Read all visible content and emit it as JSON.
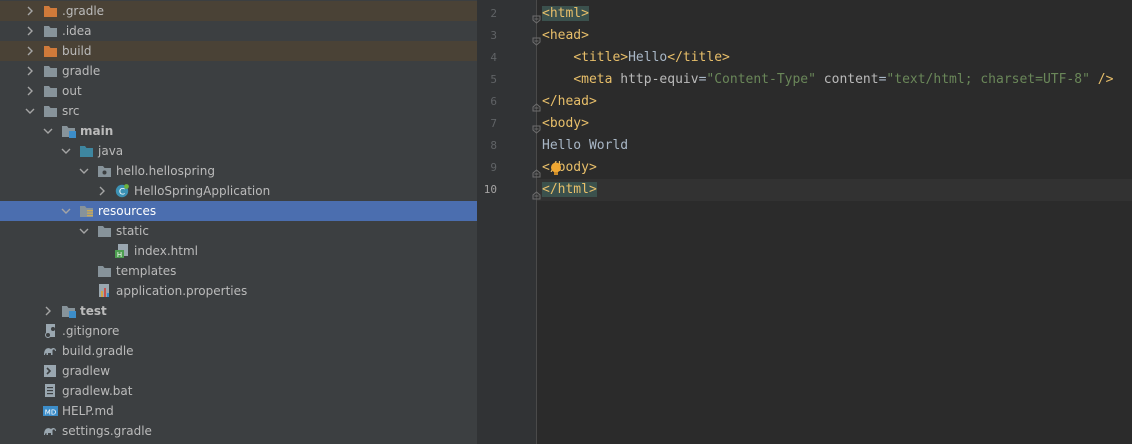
{
  "project_tree": {
    "items": [
      {
        "label": ".gradle",
        "icon": "folder-excluded-icon",
        "expand": "collapsed",
        "state": "excluded",
        "bold": false
      },
      {
        "label": ".idea",
        "icon": "folder-icon",
        "expand": "collapsed",
        "state": "normal",
        "bold": false
      },
      {
        "label": "build",
        "icon": "folder-excluded-icon",
        "expand": "collapsed",
        "state": "excluded",
        "bold": false
      },
      {
        "label": "gradle",
        "icon": "folder-icon",
        "expand": "collapsed",
        "state": "normal",
        "bold": false
      },
      {
        "label": "out",
        "icon": "folder-icon",
        "expand": "collapsed",
        "state": "normal",
        "bold": false
      },
      {
        "label": "src",
        "icon": "folder-icon",
        "expand": "expanded",
        "state": "normal",
        "bold": false
      },
      {
        "label": "main",
        "icon": "module-folder-icon",
        "expand": "expanded",
        "state": "normal",
        "bold": true
      },
      {
        "label": "java",
        "icon": "source-root-folder-icon",
        "expand": "expanded",
        "state": "normal",
        "bold": false
      },
      {
        "label": "hello.hellospring",
        "icon": "package-icon",
        "expand": "expanded",
        "state": "normal",
        "bold": false
      },
      {
        "label": "HelloSpringApplication",
        "icon": "spring-class-icon",
        "expand": "collapsed",
        "state": "normal",
        "bold": false
      },
      {
        "label": "resources",
        "icon": "resources-folder-icon",
        "expand": "expanded",
        "state": "selected",
        "bold": false
      },
      {
        "label": "static",
        "icon": "folder-icon",
        "expand": "expanded",
        "state": "normal",
        "bold": false
      },
      {
        "label": "index.html",
        "icon": "html-file-icon",
        "expand": "none",
        "state": "normal",
        "bold": false
      },
      {
        "label": "templates",
        "icon": "folder-icon",
        "expand": "none",
        "state": "normal",
        "bold": false
      },
      {
        "label": "application.properties",
        "icon": "properties-file-icon",
        "expand": "none",
        "state": "normal",
        "bold": false
      },
      {
        "label": "test",
        "icon": "module-folder-icon",
        "expand": "collapsed",
        "state": "normal",
        "bold": true
      },
      {
        "label": ".gitignore",
        "icon": "gitignore-file-icon",
        "expand": "none",
        "state": "normal",
        "bold": false
      },
      {
        "label": "build.gradle",
        "icon": "gradle-file-icon",
        "expand": "none",
        "state": "normal",
        "bold": false
      },
      {
        "label": "gradlew",
        "icon": "script-file-icon",
        "expand": "none",
        "state": "normal",
        "bold": false
      },
      {
        "label": "gradlew.bat",
        "icon": "text-file-icon",
        "expand": "none",
        "state": "normal",
        "bold": false
      },
      {
        "label": "HELP.md",
        "icon": "markdown-file-icon",
        "expand": "none",
        "state": "normal",
        "bold": false
      },
      {
        "label": "settings.gradle",
        "icon": "gradle-file-icon",
        "expand": "none",
        "state": "normal",
        "bold": false
      }
    ]
  },
  "editor": {
    "current_line": "10",
    "lines": [
      {
        "num": "2",
        "parts": [
          {
            "t": "<html>",
            "c": "tag match"
          }
        ]
      },
      {
        "num": "3",
        "parts": [
          {
            "t": "<head>",
            "c": "tag"
          }
        ]
      },
      {
        "num": "4",
        "parts": [
          {
            "t": "    ",
            "c": ""
          },
          {
            "t": "<title>",
            "c": "tag"
          },
          {
            "t": "Hello",
            "c": ""
          },
          {
            "t": "</title>",
            "c": "tag"
          }
        ]
      },
      {
        "num": "5",
        "parts": [
          {
            "t": "    ",
            "c": ""
          },
          {
            "t": "<meta ",
            "c": "tag"
          },
          {
            "t": "http-equiv",
            "c": "attr"
          },
          {
            "t": "=",
            "c": ""
          },
          {
            "t": "\"Content-Type\"",
            "c": "val"
          },
          {
            "t": " ",
            "c": ""
          },
          {
            "t": "content",
            "c": "attr"
          },
          {
            "t": "=",
            "c": ""
          },
          {
            "t": "\"text/html; charset=UTF-8\"",
            "c": "val"
          },
          {
            "t": " />",
            "c": "tag"
          }
        ]
      },
      {
        "num": "6",
        "parts": [
          {
            "t": "</head>",
            "c": "tag"
          }
        ]
      },
      {
        "num": "7",
        "parts": [
          {
            "t": "<body>",
            "c": "tag"
          }
        ]
      },
      {
        "num": "8",
        "parts": [
          {
            "t": "Hello World",
            "c": ""
          }
        ]
      },
      {
        "num": "9",
        "parts": [
          {
            "t": "</body>",
            "c": "tag"
          }
        ]
      },
      {
        "num": "10",
        "parts": [
          {
            "t": "</html>",
            "c": "tag match"
          }
        ]
      }
    ]
  },
  "colors": {
    "tree_bg": "#3c3f41",
    "selected_row": "#4b6eaf",
    "excluded_row": "#4a4236",
    "editor_bg": "#2b2b2b",
    "tag": "#e8bf6a",
    "string": "#6a8759",
    "folder": "#87939a",
    "excluded_folder": "#d07a3a",
    "source_root": "#3e86a0"
  }
}
